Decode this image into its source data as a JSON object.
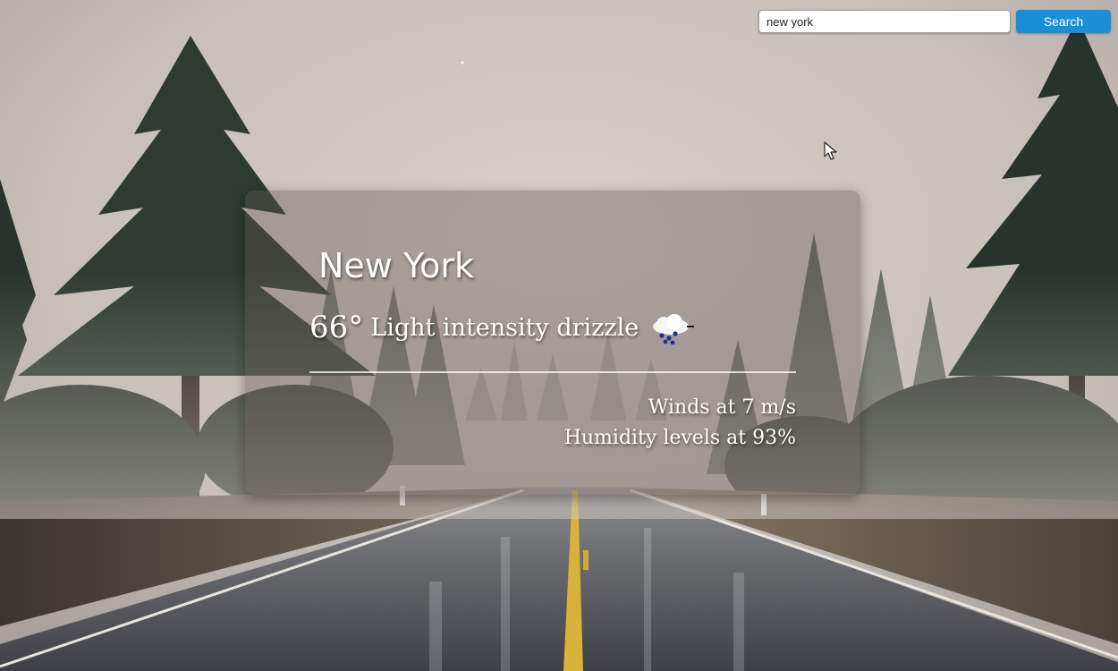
{
  "search": {
    "value": "new york",
    "button_label": "Search"
  },
  "weather": {
    "city": "New York",
    "temperature": "66°",
    "description": "Light intensity drizzle",
    "icon": "drizzle-cloud-icon",
    "wind": "Winds at 7 m/s",
    "humidity": "Humidity levels at 93%"
  },
  "colors": {
    "search_button": "#1a8fd6",
    "card_overlay": "#5f5550",
    "text": "#ffffff"
  }
}
